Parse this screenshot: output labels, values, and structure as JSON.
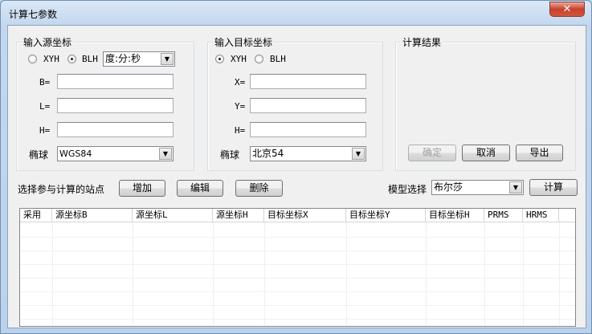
{
  "window": {
    "title": "计算七参数",
    "close_label": "✕"
  },
  "source": {
    "legend": "输入源坐标",
    "radio_xyh": "XYH",
    "radio_blh": "BLH",
    "selected": "BLH",
    "format": "度:分:秒",
    "label_b": "B=",
    "label_l": "L=",
    "label_h": "H=",
    "b": "",
    "l": "",
    "h": "",
    "ellipsoid_label": "椭球",
    "ellipsoid": "WGS84"
  },
  "target": {
    "legend": "输入目标坐标",
    "radio_xyh": "XYH",
    "radio_blh": "BLH",
    "selected": "XYH",
    "label_x": "X=",
    "label_y": "Y=",
    "label_h": "H=",
    "x": "",
    "y": "",
    "h": "",
    "ellipsoid_label": "椭球",
    "ellipsoid": "北京54"
  },
  "result": {
    "legend": "计算结果",
    "confirm": "确定",
    "cancel": "取消",
    "export": "导出"
  },
  "stations": {
    "label": "选择参与计算的站点",
    "add": "增加",
    "edit": "编辑",
    "delete": "删除",
    "model_label": "模型选择",
    "model": "布尔莎",
    "compute": "计算"
  },
  "table": {
    "columns": [
      "采用",
      "源坐标B",
      "源坐标L",
      "源坐标H",
      "目标坐标X",
      "目标坐标Y",
      "目标坐标H",
      "PRMS",
      "HRMS"
    ],
    "rows": []
  }
}
